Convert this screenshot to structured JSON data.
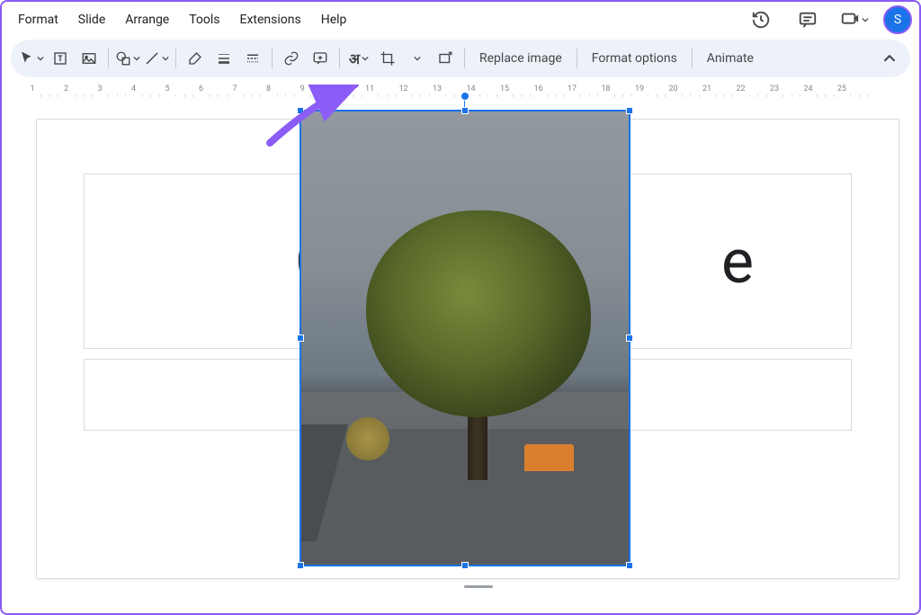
{
  "menubar": {
    "items": [
      "Format",
      "Slide",
      "Arrange",
      "Tools",
      "Extensions",
      "Help"
    ]
  },
  "topright": {
    "avatar_initial": "S"
  },
  "toolbar": {
    "replace_image": "Replace image",
    "format_options": "Format options",
    "animate": "Animate"
  },
  "ruler": {
    "ticks": [
      "1",
      "2",
      "3",
      "4",
      "5",
      "6",
      "7",
      "8",
      "9",
      "10",
      "11",
      "12",
      "13",
      "14",
      "15",
      "16",
      "17",
      "18",
      "19",
      "20",
      "21",
      "22",
      "23",
      "24",
      "25"
    ]
  },
  "slide": {
    "title_left": "C",
    "title_right": "e"
  }
}
